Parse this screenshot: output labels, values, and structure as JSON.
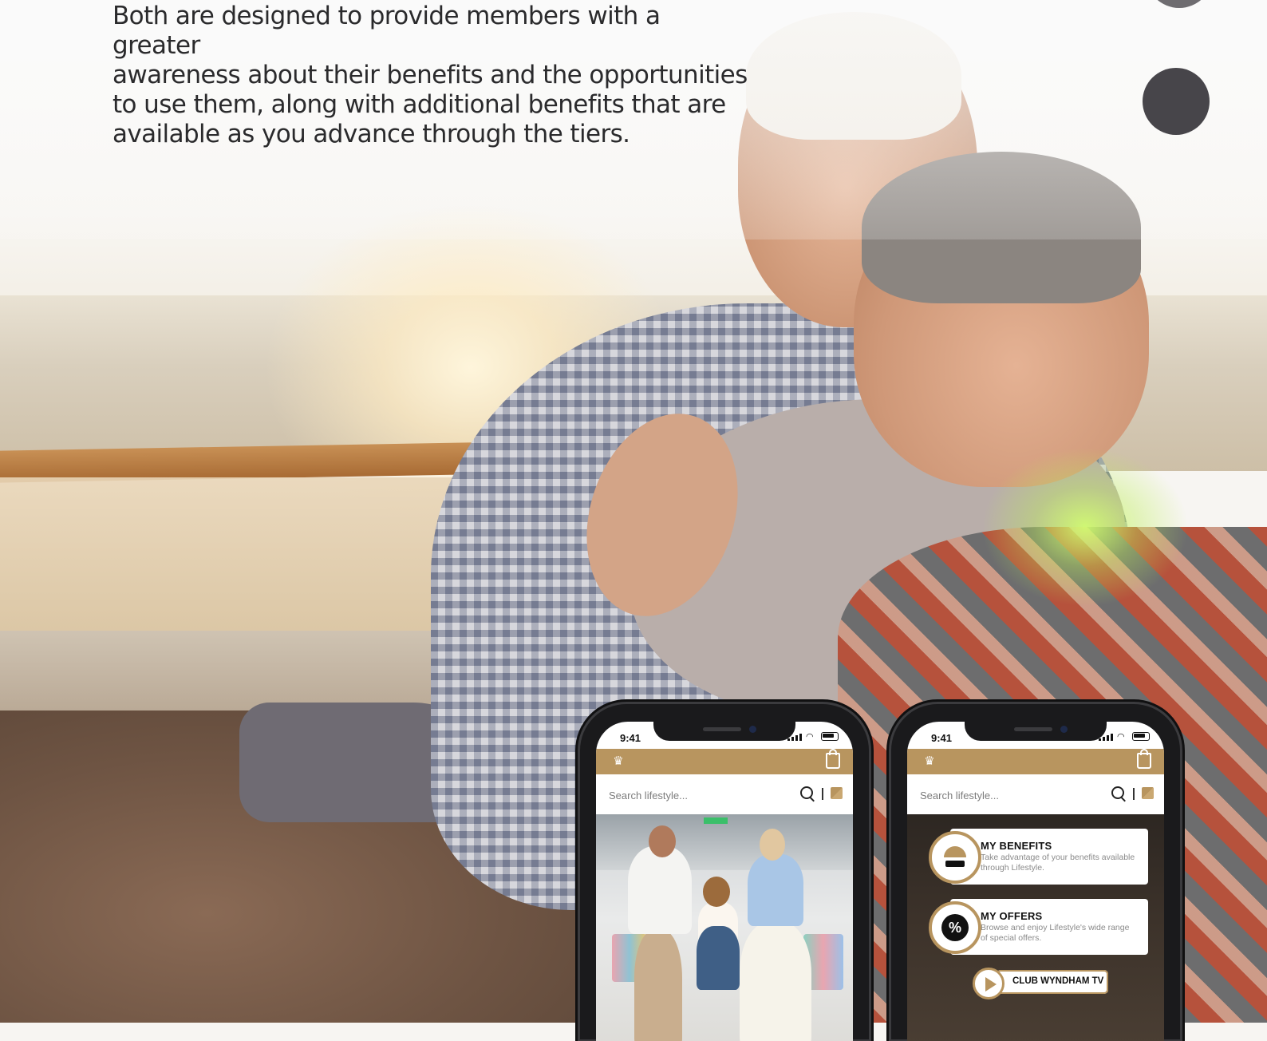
{
  "intro": {
    "lines": [
      "Both are designed to provide members with a greater",
      "awareness about their benefits and the opportunities",
      "to use them, along with additional benefits that are",
      "available as you advance through the tiers."
    ]
  },
  "phone_left": {
    "time": "9:41",
    "search_placeholder": "Search lifestyle..."
  },
  "phone_right": {
    "time": "9:41",
    "search_placeholder": "Search lifestyle...",
    "cards": [
      {
        "title": "MY BENEFITS",
        "description": "Take advantage of your benefits available through Lifestyle.",
        "icon": "beach-umbrella-icon"
      },
      {
        "title": "MY OFFERS",
        "description": "Browse and enjoy Lifestyle's wide range of special offers.",
        "icon": "percent-badge-icon"
      }
    ],
    "tv_label": "CLUB WYNDHAM TV"
  },
  "colors": {
    "brand_gold": "#b8955f",
    "pager_dot_active": "#47454a",
    "pager_dot_inactive": "#6e6c70"
  }
}
